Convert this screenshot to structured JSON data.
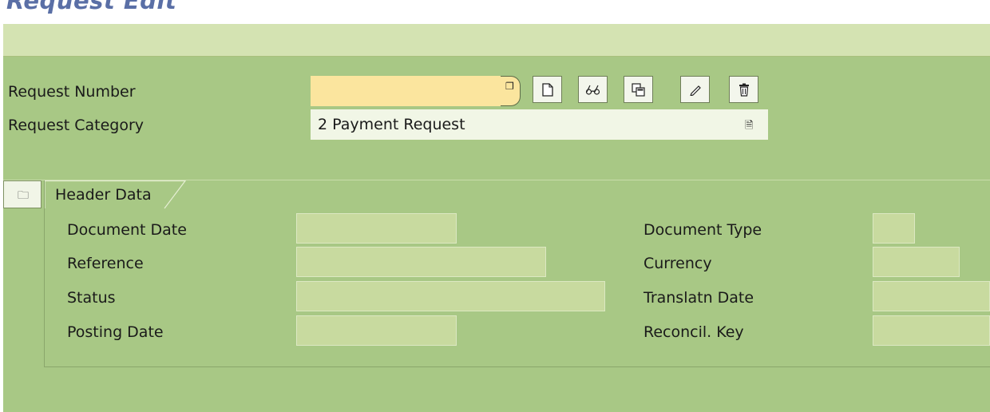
{
  "page": {
    "title": "Request Edit"
  },
  "form": {
    "request_number": {
      "label": "Request Number",
      "value": ""
    },
    "request_category": {
      "label": "Request Category",
      "value": "2 Payment Request"
    }
  },
  "toolbar": {
    "buttons": [
      {
        "name": "create-button",
        "icon": "new-document-icon"
      },
      {
        "name": "display-button",
        "icon": "glasses-icon"
      },
      {
        "name": "copy-button",
        "icon": "copy-icon"
      },
      {
        "name": "edit-button",
        "icon": "pencil-icon"
      },
      {
        "name": "delete-button",
        "icon": "trash-icon"
      }
    ]
  },
  "header_data": {
    "tab_label": "Header Data",
    "left_fields": [
      {
        "label": "Document Date",
        "value": ""
      },
      {
        "label": "Reference",
        "value": ""
      },
      {
        "label": "Status",
        "value": ""
      },
      {
        "label": "Posting Date",
        "value": ""
      }
    ],
    "right_fields": [
      {
        "label": "Document Type",
        "value": ""
      },
      {
        "label": "Currency",
        "value": ""
      },
      {
        "label": "Translatn Date",
        "value": ""
      },
      {
        "label": "Reconcil. Key",
        "value": ""
      }
    ]
  },
  "colors": {
    "title": "#5a6fa6",
    "toolbar_bg": "#d4e3b2",
    "main_bg": "#a8c885",
    "required_field": "#fbe59e",
    "display_field": "#c8da9f"
  }
}
